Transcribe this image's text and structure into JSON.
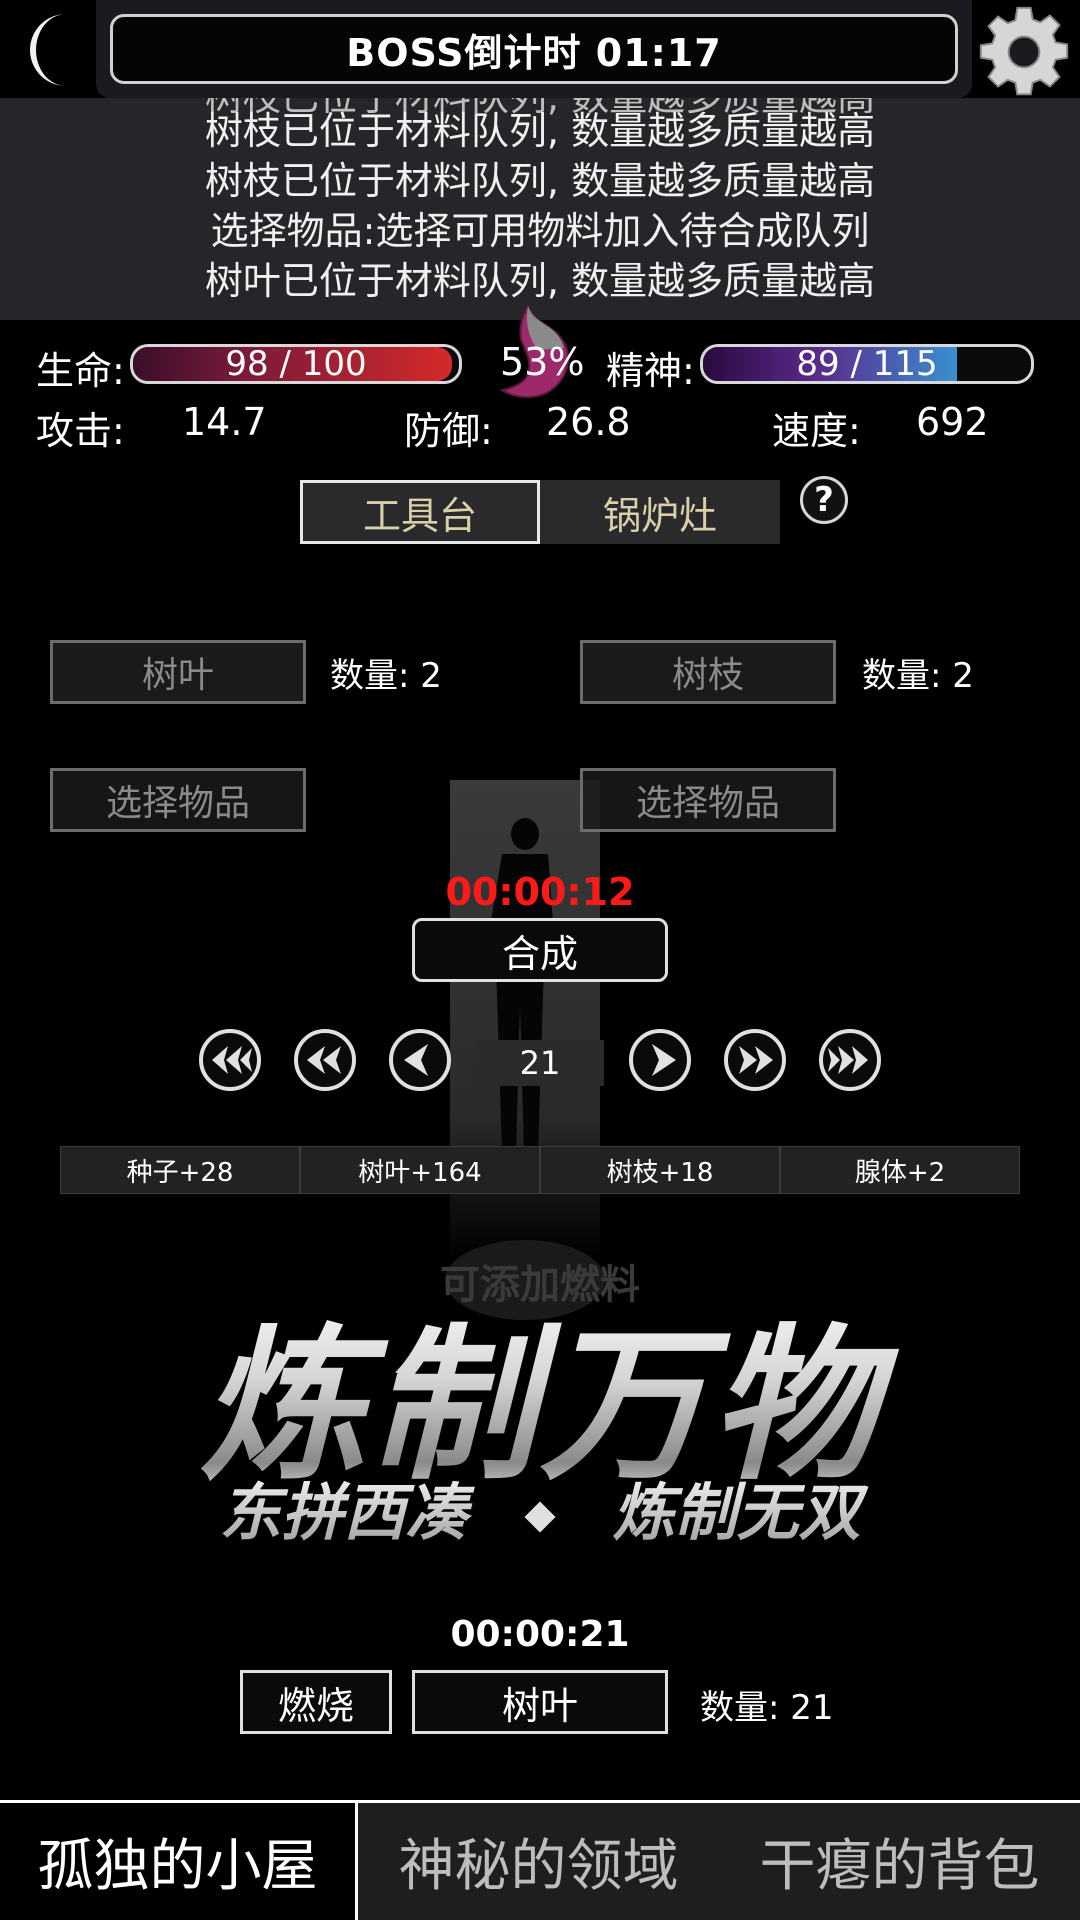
{
  "header": {
    "boss_countdown": "BOSS倒计时 01:17"
  },
  "log": {
    "lines": [
      "树枝已位于材料队列, 数量越多质量越高",
      "树枝已位于材料队列, 数量越多质量越高",
      "选择物品:选择可用物料加入待合成队列",
      "树叶已位于材料队列, 数量越多质量越高"
    ]
  },
  "stats": {
    "hp_label": "生命:",
    "hp_text": "98 / 100",
    "hp_fraction": 0.98,
    "hunger_percent": "53%",
    "mp_label": "精神:",
    "mp_text": "89 / 115",
    "mp_fraction": 0.774,
    "attack_label": "攻击:",
    "attack_value": "14.7",
    "defense_label": "防御:",
    "defense_value": "26.8",
    "speed_label": "速度:",
    "speed_value": "692"
  },
  "tabs": {
    "workbench": "工具台",
    "stove": "锅炉灶",
    "help": "?"
  },
  "materials": {
    "slot1_name": "树叶",
    "slot1_qty": "数量: 2",
    "slot2_name": "树枝",
    "slot2_qty": "数量: 2",
    "slot3_name": "选择物品",
    "slot4_name": "选择物品"
  },
  "craft": {
    "timer": "00:00:12",
    "button": "合成"
  },
  "pager": {
    "current": "21"
  },
  "resources": [
    "种子+28",
    "树叶+164",
    "树枝+18",
    "腺体+2"
  ],
  "promo": {
    "ghost_text": "可添加燃料",
    "title": "炼制万物",
    "subtitle_left": "东拼西凑",
    "subtitle_right": "炼制无双"
  },
  "fuel": {
    "timer": "00:00:21",
    "burn_button": "燃烧",
    "fuel_item": "树叶",
    "fuel_qty": "数量: 21"
  },
  "bottom_nav": {
    "tab1": "孤独的小屋",
    "tab2": "神秘的领域",
    "tab3": "干瘪的背包"
  },
  "colors": {
    "hp_fill": "#d42a2a",
    "mp_fill": "#3a8fd0",
    "timer_red": "#ff1a1a",
    "tab_text": "#d9cfa8"
  }
}
